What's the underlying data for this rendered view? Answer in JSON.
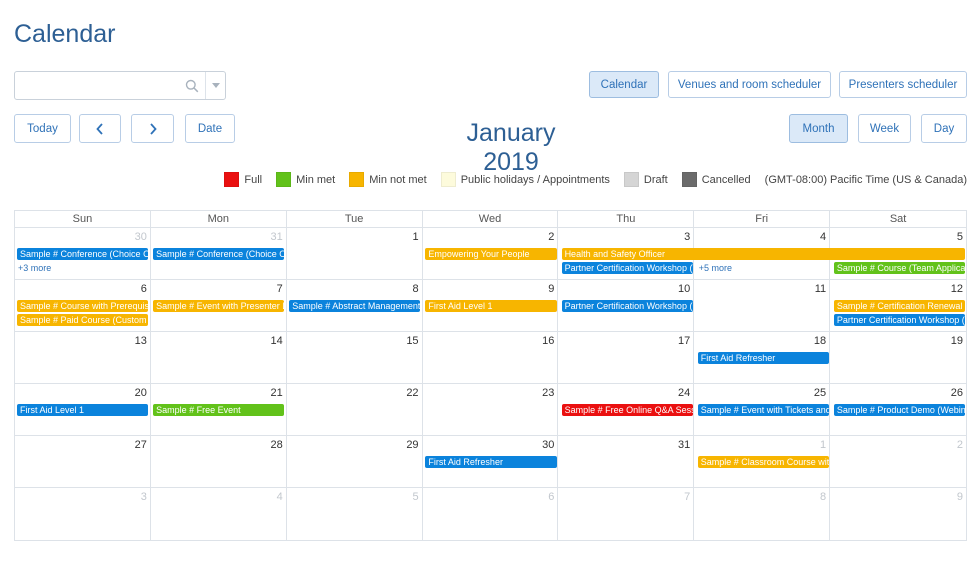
{
  "page": {
    "title": "Calendar"
  },
  "search": {
    "value": "",
    "placeholder": ""
  },
  "views": {
    "calendar": "Calendar",
    "venues": "Venues and room scheduler",
    "presenters": "Presenters scheduler"
  },
  "nav": {
    "today": "Today",
    "prev": "‹",
    "next": "›",
    "date": "Date"
  },
  "month_title": "January 2019",
  "range": {
    "month": "Month",
    "week": "Week",
    "day": "Day",
    "active": "month"
  },
  "legend": {
    "items": [
      {
        "label": "Full",
        "color": "#ea1010"
      },
      {
        "label": "Min met",
        "color": "#62c21a"
      },
      {
        "label": "Min not met",
        "color": "#f7b500"
      },
      {
        "label": "Public holidays / Appointments",
        "color": "#fdfbdc"
      },
      {
        "label": "Draft",
        "color": "#d5d5d5"
      },
      {
        "label": "Cancelled",
        "color": "#6b6b6b"
      }
    ],
    "timezone": "(GMT-08:00) Pacific Time (US & Canada)"
  },
  "colors": {
    "blue": "#0b83dc",
    "orange": "#f7b500",
    "green": "#62c21a",
    "red": "#ea1010",
    "accent": "#2d5f94"
  },
  "days_of_week": [
    "Sun",
    "Mon",
    "Tue",
    "Wed",
    "Thu",
    "Fri",
    "Sat"
  ],
  "weeks": [
    {
      "days": [
        {
          "n": "30",
          "other": true
        },
        {
          "n": "31",
          "other": true
        },
        {
          "n": "1"
        },
        {
          "n": "2"
        },
        {
          "n": "3"
        },
        {
          "n": "4"
        },
        {
          "n": "5"
        }
      ],
      "events": [
        {
          "title": "Sample # Conference (Choice Of Sessions)",
          "color": "blue",
          "start": 0,
          "span": 1,
          "row": 0
        },
        {
          "title": "Sample # Conference (Choice Of Sessions)",
          "color": "blue",
          "start": 1,
          "span": 1,
          "row": 0
        },
        {
          "title": "Empowering Your People",
          "color": "orange",
          "start": 3,
          "span": 1,
          "row": 0
        },
        {
          "title": "Health and Safety Officer",
          "color": "orange",
          "start": 4,
          "span": 3,
          "row": 0
        },
        {
          "title": "Partner Certification Workshop (Three Day)",
          "color": "blue",
          "start": 4,
          "span": 1,
          "row": 1
        },
        {
          "title": "Sample # Course (Team Application)",
          "color": "green",
          "start": 6,
          "span": 1,
          "row": 1
        }
      ],
      "more": [
        {
          "label": "+3 more",
          "col": 0
        },
        {
          "label": "+5 more",
          "col": 5
        }
      ]
    },
    {
      "days": [
        {
          "n": "6"
        },
        {
          "n": "7"
        },
        {
          "n": "8"
        },
        {
          "n": "9"
        },
        {
          "n": "10"
        },
        {
          "n": "11"
        },
        {
          "n": "12"
        }
      ],
      "events": [
        {
          "title": "Sample # Course with Prerequisites",
          "color": "orange",
          "start": 0,
          "span": 1,
          "row": 0
        },
        {
          "title": "Sample # Paid Course (Custom Fields)",
          "color": "orange",
          "start": 0,
          "span": 1,
          "row": 1
        },
        {
          "title": "Sample # Event with Presenter Login",
          "color": "orange",
          "start": 1,
          "span": 1,
          "row": 0
        },
        {
          "title": "Sample # Abstract Management Conference",
          "color": "blue",
          "start": 2,
          "span": 1,
          "row": 0
        },
        {
          "title": "First Aid Level 1",
          "color": "orange",
          "start": 3,
          "span": 1,
          "row": 0
        },
        {
          "title": "Partner Certification Workshop (One Day)",
          "color": "blue",
          "start": 4,
          "span": 1,
          "row": 0
        },
        {
          "title": "Sample # Certification Renewal",
          "color": "orange",
          "start": 6,
          "span": 1,
          "row": 0
        },
        {
          "title": "Partner Certification Workshop (Two Day)",
          "color": "blue",
          "start": 6,
          "span": 1,
          "row": 1
        }
      ],
      "more": []
    },
    {
      "days": [
        {
          "n": "13"
        },
        {
          "n": "14"
        },
        {
          "n": "15"
        },
        {
          "n": "16"
        },
        {
          "n": "17"
        },
        {
          "n": "18"
        },
        {
          "n": "19"
        }
      ],
      "events": [
        {
          "title": "First Aid Refresher",
          "color": "blue",
          "start": 5,
          "span": 1,
          "row": 0
        }
      ],
      "more": []
    },
    {
      "days": [
        {
          "n": "20"
        },
        {
          "n": "21"
        },
        {
          "n": "22"
        },
        {
          "n": "23"
        },
        {
          "n": "24"
        },
        {
          "n": "25"
        },
        {
          "n": "26"
        }
      ],
      "events": [
        {
          "title": "First Aid Level 1",
          "color": "blue",
          "start": 0,
          "span": 1,
          "row": 0
        },
        {
          "title": "Sample # Free Event",
          "color": "green",
          "start": 1,
          "span": 1,
          "row": 0
        },
        {
          "title": "Sample # Free Online Q&A Session",
          "color": "red",
          "start": 4,
          "span": 1,
          "row": 0
        },
        {
          "title": "Sample # Event with Tickets and Sessions",
          "color": "blue",
          "start": 5,
          "span": 1,
          "row": 0
        },
        {
          "title": "Sample # Product Demo (Webinar)",
          "color": "blue",
          "start": 6,
          "span": 1,
          "row": 0
        }
      ],
      "more": []
    },
    {
      "days": [
        {
          "n": "27"
        },
        {
          "n": "28"
        },
        {
          "n": "29"
        },
        {
          "n": "30"
        },
        {
          "n": "31"
        },
        {
          "n": "1",
          "other": true
        },
        {
          "n": "2",
          "other": true
        }
      ],
      "events": [
        {
          "title": "First Aid Refresher",
          "color": "blue",
          "start": 3,
          "span": 1,
          "row": 0
        },
        {
          "title": "Sample # Classroom Course with Fees",
          "color": "orange",
          "start": 5,
          "span": 1,
          "row": 0
        }
      ],
      "more": []
    },
    {
      "days": [
        {
          "n": "3",
          "other": true
        },
        {
          "n": "4",
          "other": true
        },
        {
          "n": "5",
          "other": true
        },
        {
          "n": "6",
          "other": true
        },
        {
          "n": "7",
          "other": true
        },
        {
          "n": "8",
          "other": true
        },
        {
          "n": "9",
          "other": true
        }
      ],
      "events": [],
      "more": []
    }
  ]
}
